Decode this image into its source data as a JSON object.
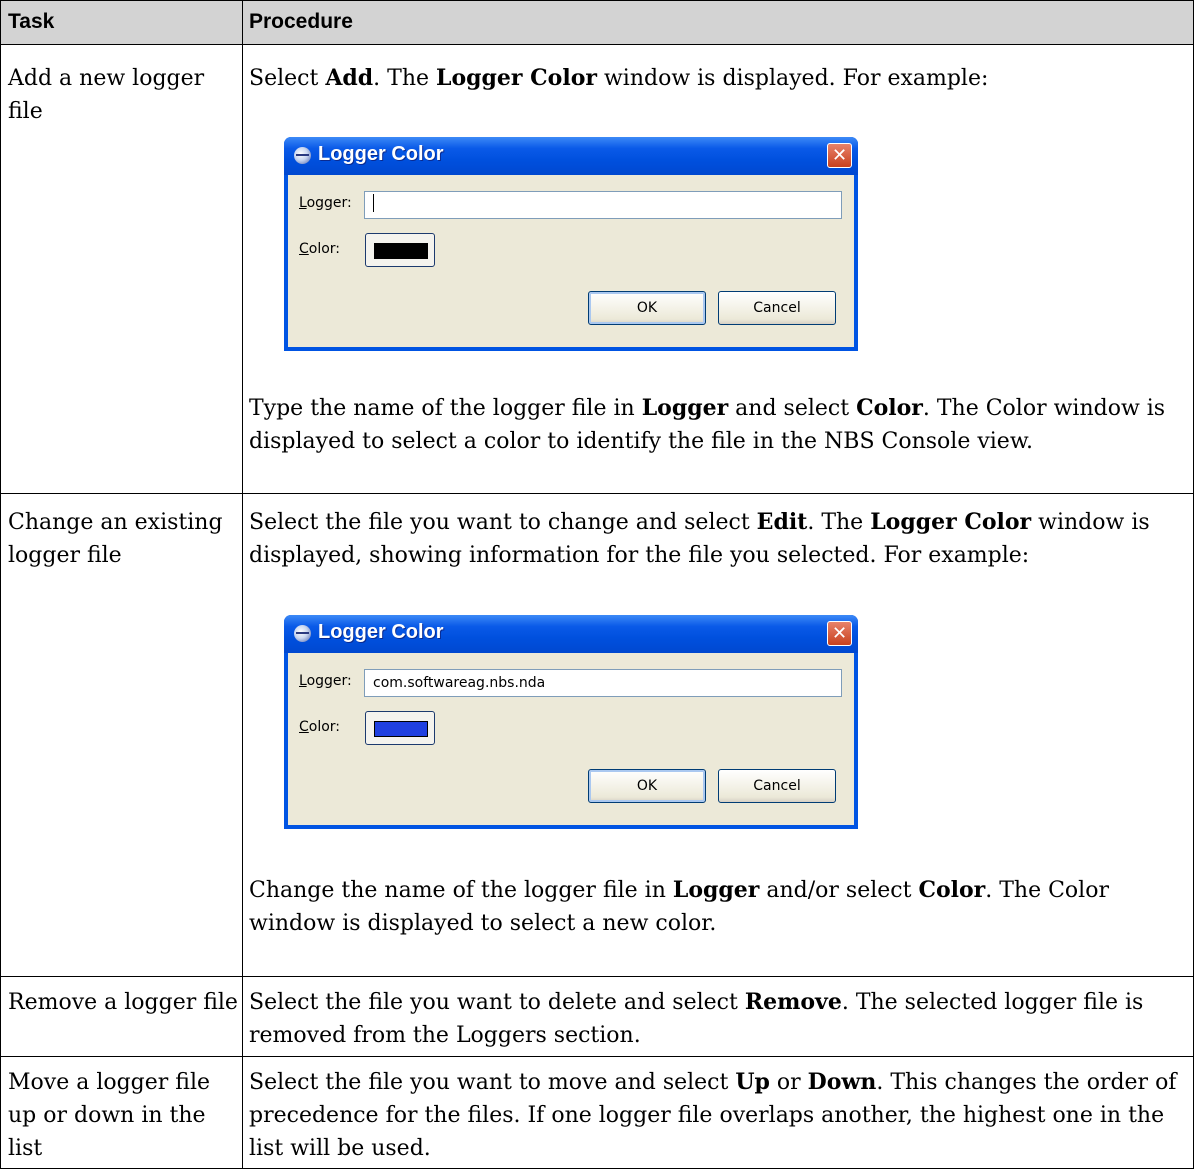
{
  "header": {
    "task": "Task",
    "procedure": "Procedure"
  },
  "rows": [
    {
      "task": "Add a new logger file",
      "p1": {
        "a": "Select ",
        "b1": "Add",
        "c": ". The ",
        "b2": "Logger Color",
        "d": " window is displayed. For example:"
      },
      "p2": {
        "a": "Type the name of the logger file in ",
        "b1": "Logger",
        "c": " and select ",
        "b2": "Color",
        "d": ". The Color window is displayed to select a color to identify the file in the NBS Console view."
      }
    },
    {
      "task": "Change an existing logger file",
      "p1": {
        "a": "Select the file you want to change and select ",
        "b1": "Edit",
        "c": ". The ",
        "b2": "Logger Color",
        "d": " window is displayed, showing information for the file you selected. For example:"
      },
      "p2": {
        "a": "Change the name of the logger file in ",
        "b1": "Logger",
        "c": " and/or select ",
        "b2": "Color",
        "d": ". The Color window is displayed to select a new color."
      }
    },
    {
      "task": "Remove a logger file",
      "p1": {
        "a": "Select the file you want to delete and select ",
        "b1": "Remove",
        "d": ". The selected logger file is removed from the Loggers section."
      }
    },
    {
      "task": "Move a logger file up or down in the list",
      "p1": {
        "a": "Select the file you want to move and select ",
        "b1": "Up",
        "c": " or ",
        "b2": "Down",
        "d": ". This changes the order of precedence for the files. If one logger file overlaps another, the highest one in the list will be used."
      }
    }
  ],
  "dialogs": [
    {
      "title": "Logger Color",
      "close_glyph": "✕",
      "logger_label_u": "L",
      "logger_label_rest": "ogger:",
      "logger_value": "",
      "color_label_u": "C",
      "color_label_rest": "olor:",
      "swatch_color": "#000000",
      "ok": "OK",
      "cancel": "Cancel"
    },
    {
      "title": "Logger Color",
      "close_glyph": "✕",
      "logger_label_u": "L",
      "logger_label_rest": "ogger:",
      "logger_value": "com.softwareag.nbs.nda",
      "color_label_u": "C",
      "color_label_rest": "olor:",
      "swatch_color": "#2040e0",
      "ok": "OK",
      "cancel": "Cancel"
    }
  ]
}
